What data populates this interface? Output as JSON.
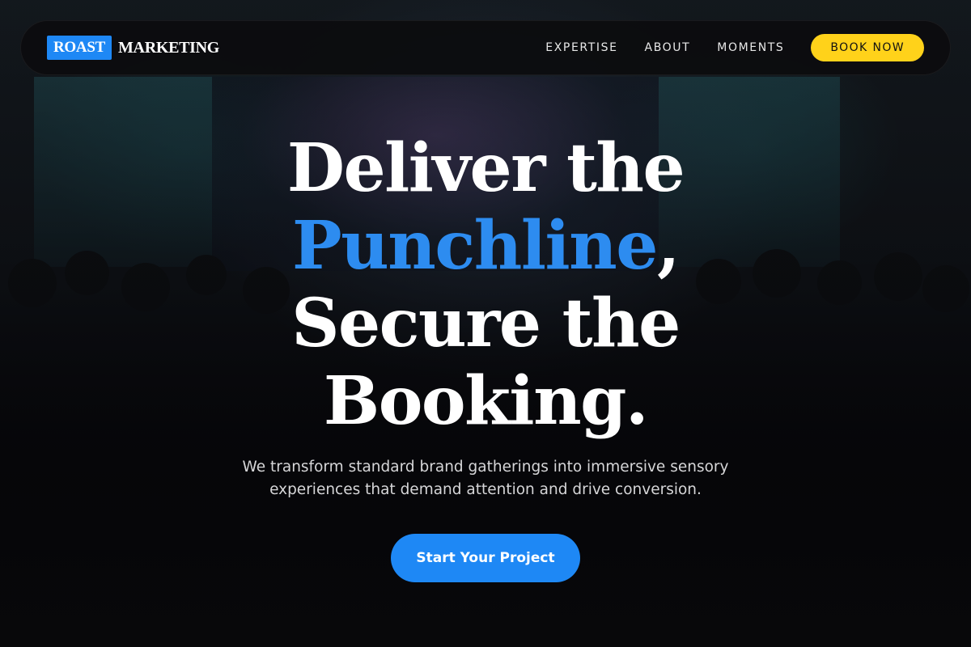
{
  "brand": {
    "mark": "ROAST",
    "name": "MARKETING"
  },
  "nav": {
    "links": [
      "EXPERTISE",
      "ABOUT",
      "MOMENTS"
    ],
    "cta_label": "BOOK NOW"
  },
  "hero": {
    "line1": "Deliver the",
    "accent": "Punchline",
    "comma": ",",
    "line3": "Secure the",
    "line4": "Booking.",
    "subtitle": "We transform standard brand gatherings into immersive sensory experiences that demand attention and drive conversion.",
    "cta_label": "Start Your Project"
  },
  "colors": {
    "accent_blue": "#1e88f5",
    "book_yellow": "#ffd21a",
    "background": "#0a0a0c"
  }
}
